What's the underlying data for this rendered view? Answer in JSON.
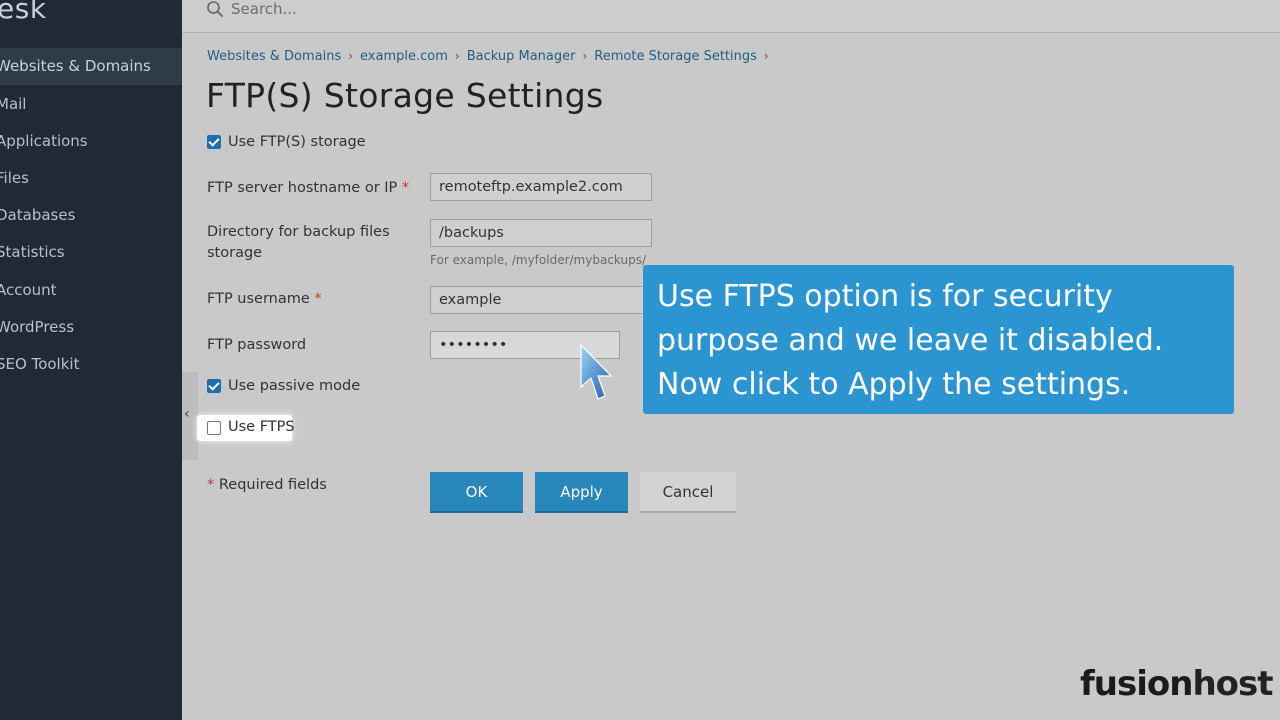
{
  "sidebar": {
    "brand": "esk",
    "items": [
      {
        "label": "Websites & Domains"
      },
      {
        "label": "Mail"
      },
      {
        "label": "Applications"
      },
      {
        "label": "Files"
      },
      {
        "label": "Databases"
      },
      {
        "label": "Statistics"
      },
      {
        "label": "Account"
      },
      {
        "label": "WordPress"
      },
      {
        "label": "SEO Toolkit"
      }
    ],
    "collapse_icon": "chevron-left-icon"
  },
  "search": {
    "placeholder": "Search...",
    "icon": "search-icon"
  },
  "breadcrumb": {
    "items": [
      "Websites & Domains",
      "example.com",
      "Backup Manager",
      "Remote Storage Settings"
    ],
    "separator": "›"
  },
  "page": {
    "title": "FTP(S) Storage Settings"
  },
  "form": {
    "use_ftp_storage": {
      "label": "Use FTP(S) storage",
      "checked": true
    },
    "hostname": {
      "label": "FTP server hostname or IP",
      "required_mark": "*",
      "value": "remoteftp.example2.com"
    },
    "directory": {
      "label_line1": "Directory for backup files",
      "label_line2": "storage",
      "value": "/backups",
      "hint": "For example, /myfolder/mybackups/"
    },
    "username": {
      "label": "FTP username",
      "required_mark": "*",
      "value": "example"
    },
    "password": {
      "label": "FTP password",
      "value": "••••••••"
    },
    "passive_mode": {
      "label": "Use passive mode",
      "checked": true
    },
    "use_ftps": {
      "label": "Use FTPS",
      "checked": false
    },
    "required_note": {
      "mark": "*",
      "text": "Required fields"
    }
  },
  "buttons": {
    "ok": "OK",
    "apply": "Apply",
    "cancel": "Cancel"
  },
  "callout": {
    "text": "Use FTPS option is for security purpose and we leave it disabled. Now click to Apply the settings."
  },
  "logo": {
    "part1": "fusion",
    "part2": "host"
  },
  "colors": {
    "accent": "#2887ba",
    "callout": "#2b95d2",
    "sidebar": "#1f2a36",
    "required": "#c0392b"
  }
}
